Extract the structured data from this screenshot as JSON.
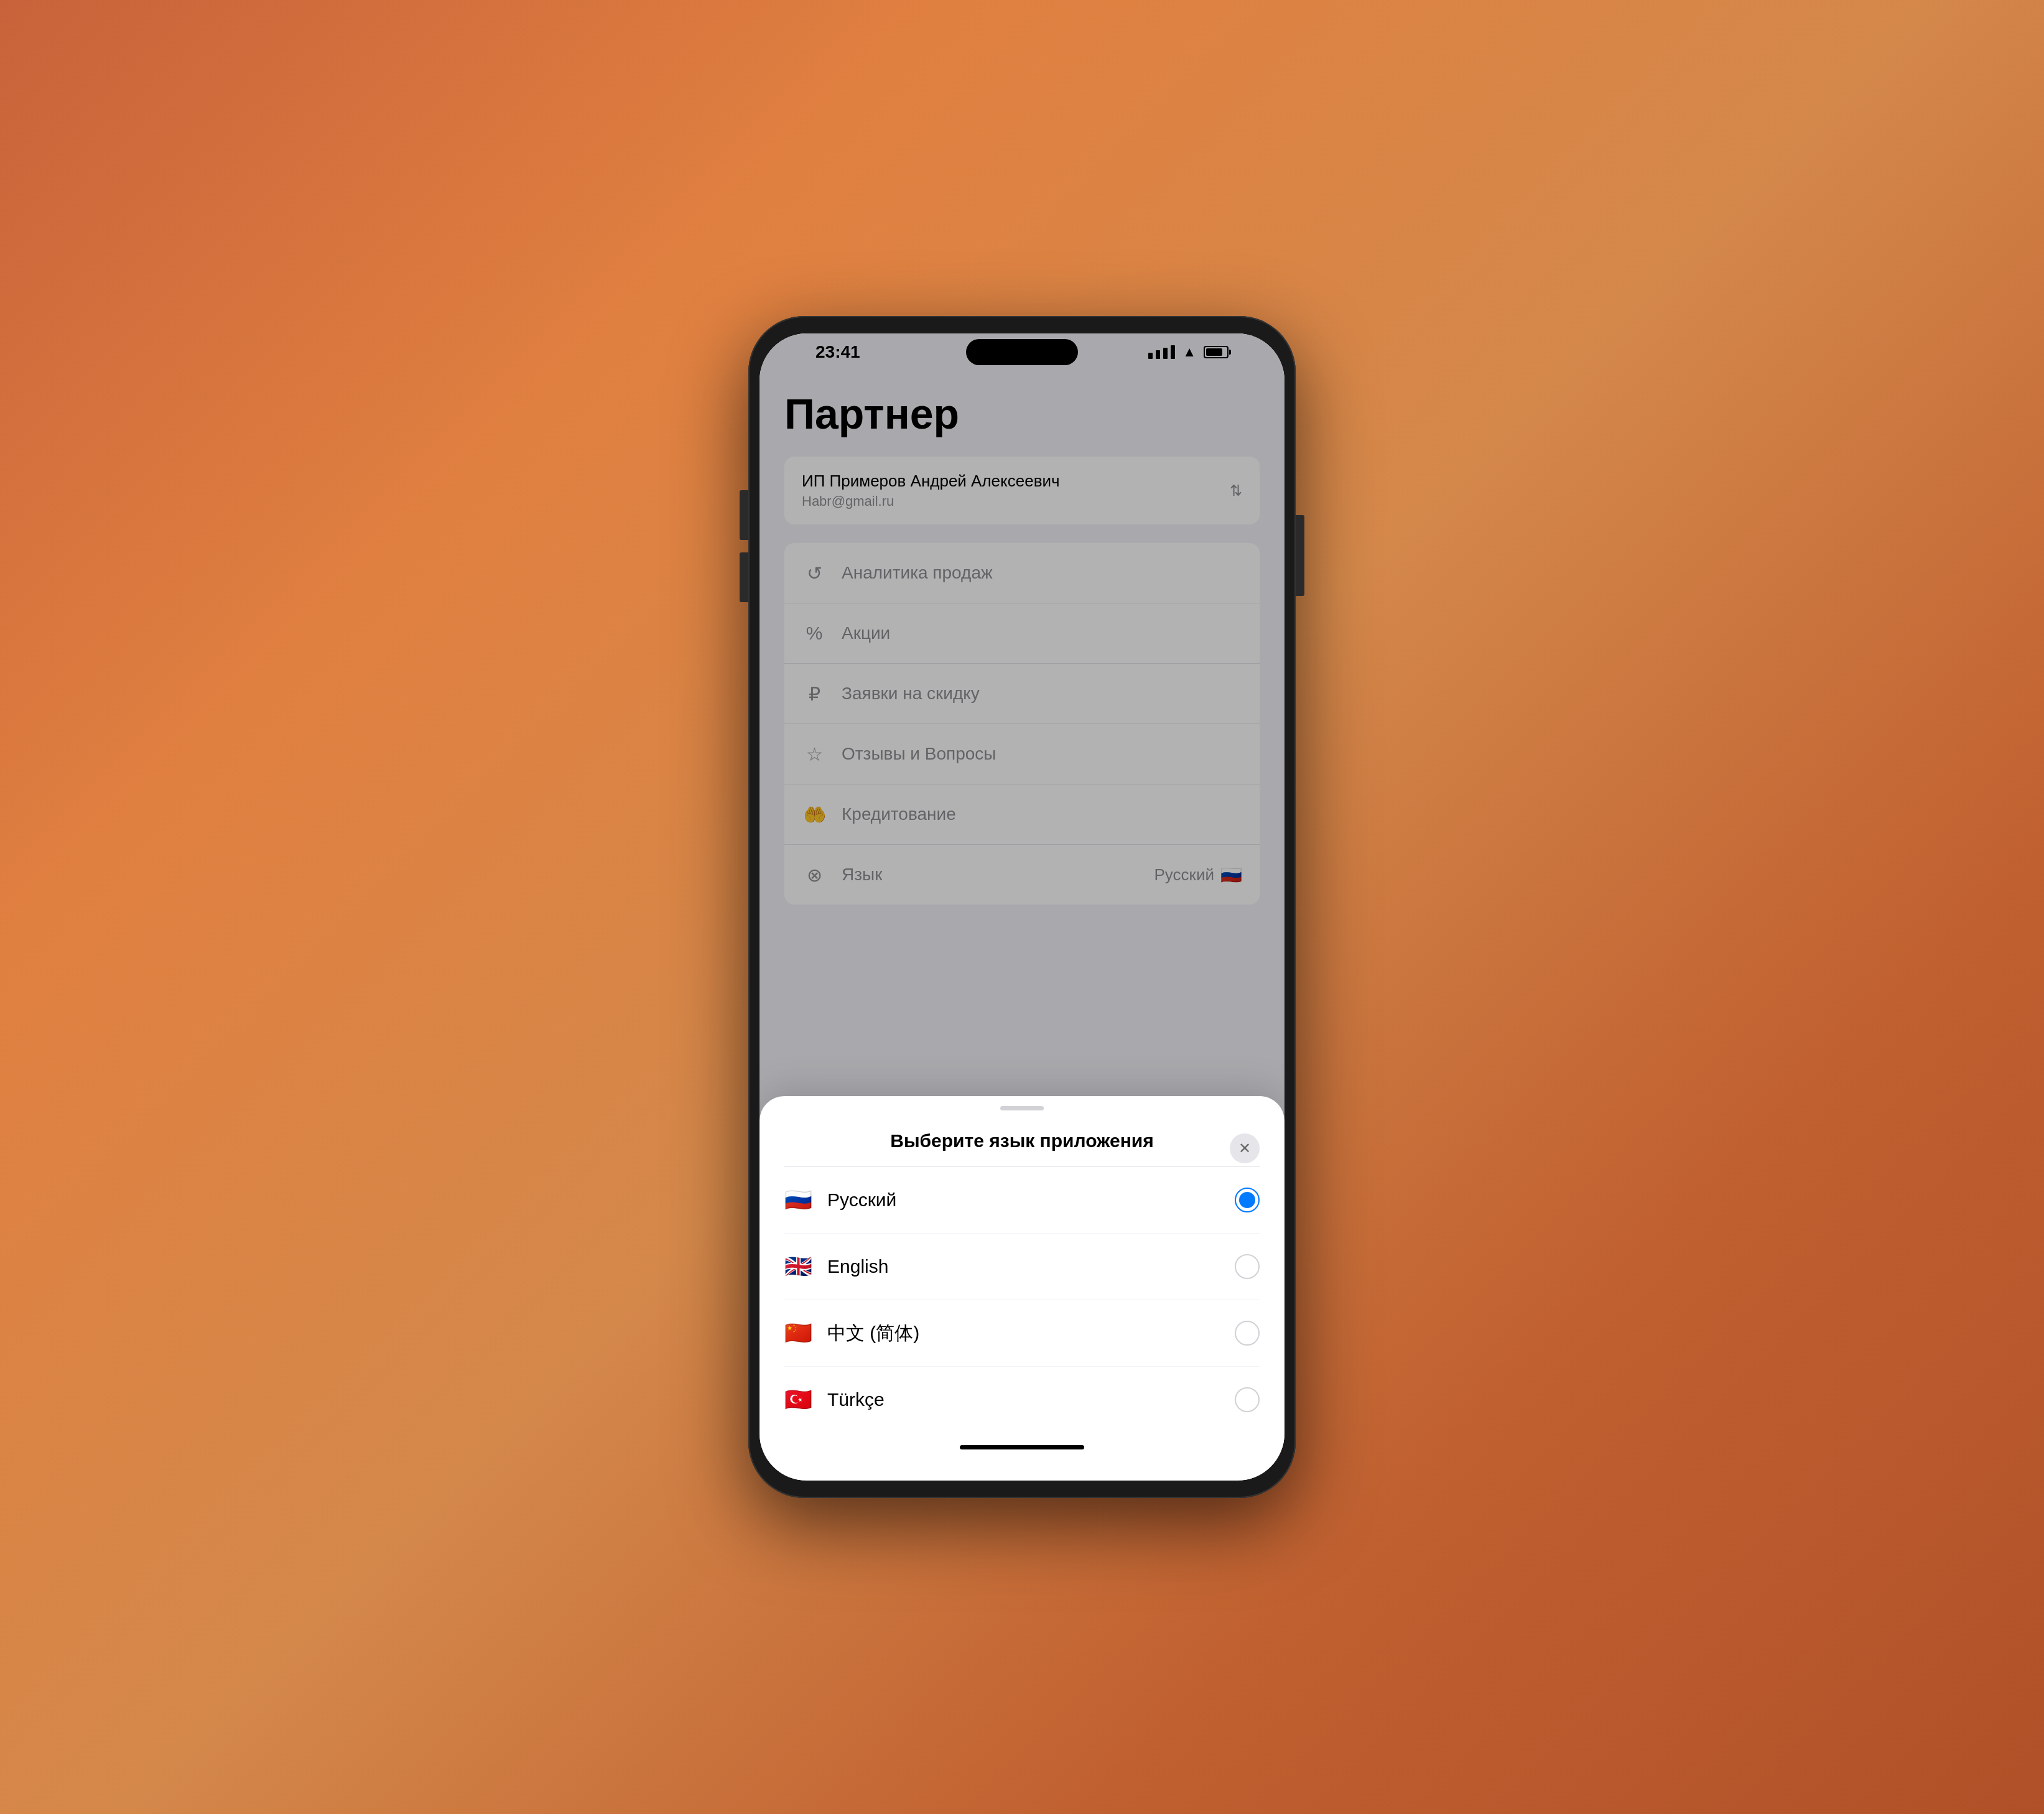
{
  "statusBar": {
    "time": "23:41"
  },
  "app": {
    "title": "Партнер",
    "partner": {
      "name": "ИП Примеров Андрей Алексеевич",
      "email": "Habr@gmail.ru"
    },
    "menuItems": [
      {
        "id": "analytics",
        "icon": "analytics-icon",
        "label": "Аналитика продаж",
        "rightText": "",
        "rightFlag": ""
      },
      {
        "id": "promo",
        "icon": "promo-icon",
        "label": "Акции",
        "rightText": "",
        "rightFlag": ""
      },
      {
        "id": "discount",
        "icon": "discount-icon",
        "label": "Заявки на скидку",
        "rightText": "",
        "rightFlag": ""
      },
      {
        "id": "reviews",
        "icon": "reviews-icon",
        "label": "Отзывы и Вопросы",
        "rightText": "",
        "rightFlag": ""
      },
      {
        "id": "credit",
        "icon": "credit-icon",
        "label": "Кредитование",
        "rightText": "",
        "rightFlag": ""
      },
      {
        "id": "language",
        "icon": "language-icon-m",
        "label": "Язык",
        "rightText": "Русский",
        "rightFlag": "🇷🇺"
      }
    ]
  },
  "languageSheet": {
    "title": "Выберите язык приложения",
    "languages": [
      {
        "id": "ru",
        "flag": "🇷🇺",
        "name": "Русский",
        "selected": true
      },
      {
        "id": "en",
        "flag": "🇬🇧",
        "name": "English",
        "selected": false
      },
      {
        "id": "zh",
        "flag": "🇨🇳",
        "name": "中文 (简体)",
        "selected": false
      },
      {
        "id": "tr",
        "flag": "🇹🇷",
        "name": "Türkçe",
        "selected": false
      }
    ]
  }
}
